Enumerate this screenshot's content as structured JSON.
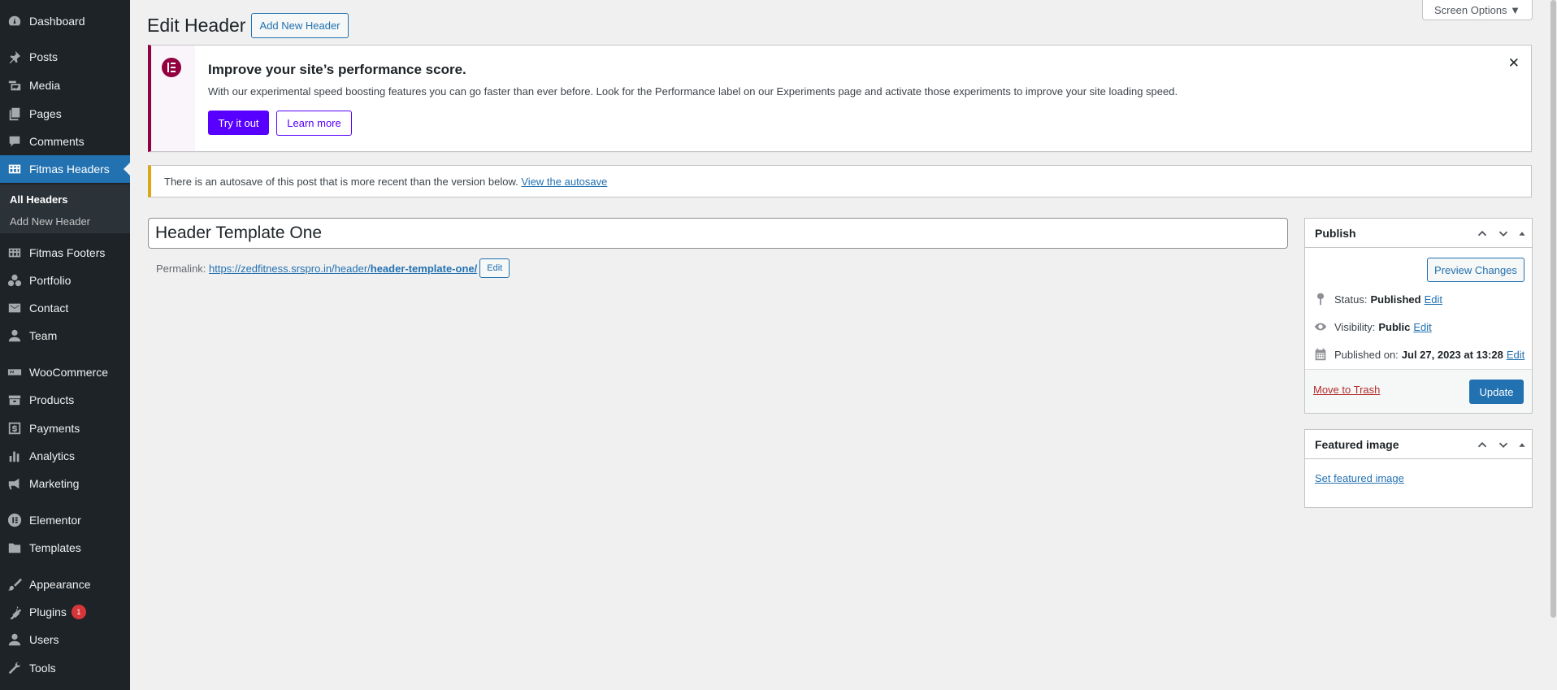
{
  "sidebar": {
    "items": [
      {
        "label": "Dashboard",
        "icon": "dashboard-icon"
      },
      {
        "label": "Posts",
        "icon": "pin-icon"
      },
      {
        "label": "Media",
        "icon": "media-icon"
      },
      {
        "label": "Pages",
        "icon": "pages-icon"
      },
      {
        "label": "Comments",
        "icon": "comments-icon"
      },
      {
        "label": "Fitmas Headers",
        "icon": "grid-icon"
      },
      {
        "label": "Fitmas Footers",
        "icon": "grid-icon"
      },
      {
        "label": "Portfolio",
        "icon": "portfolio-icon"
      },
      {
        "label": "Contact",
        "icon": "mail-icon"
      },
      {
        "label": "Team",
        "icon": "user-icon"
      },
      {
        "label": "WooCommerce",
        "icon": "woo-icon"
      },
      {
        "label": "Products",
        "icon": "products-icon"
      },
      {
        "label": "Payments",
        "icon": "payments-icon"
      },
      {
        "label": "Analytics",
        "icon": "analytics-icon"
      },
      {
        "label": "Marketing",
        "icon": "megaphone-icon"
      },
      {
        "label": "Elementor",
        "icon": "elementor-icon"
      },
      {
        "label": "Templates",
        "icon": "folder-icon"
      },
      {
        "label": "Appearance",
        "icon": "brush-icon"
      },
      {
        "label": "Plugins",
        "icon": "plugin-icon",
        "badge": "1"
      },
      {
        "label": "Users",
        "icon": "user-icon"
      },
      {
        "label": "Tools",
        "icon": "wrench-icon"
      }
    ],
    "submenu": {
      "all": "All Headers",
      "add": "Add New Header"
    }
  },
  "header": {
    "title": "Edit Header",
    "add_new": "Add New Header",
    "screen_options": "Screen Options ▼"
  },
  "notice": {
    "title": "Improve your site’s performance score.",
    "text": "With our experimental speed boosting features you can go faster than ever before. Look for the Performance label on our Experiments page and activate those experiments to improve your site loading speed.",
    "try": "Try it out",
    "learn": "Learn more",
    "close": "✕"
  },
  "autosave": {
    "text": "There is an autosave of this post that is more recent than the version below.",
    "link": "View the autosave"
  },
  "editor": {
    "title_value": "Header Template One",
    "permalink_label": "Permalink:",
    "permalink_base": "https://zedfitness.srspro.in/header/",
    "permalink_slug": "header-template-one/",
    "edit": "Edit"
  },
  "publish": {
    "title": "Publish",
    "preview": "Preview Changes",
    "status_label": "Status:",
    "status_value": "Published",
    "visibility_label": "Visibility:",
    "visibility_value": "Public",
    "published_label": "Published on:",
    "published_value": "Jul 27, 2023 at 13:28",
    "edit": "Edit",
    "trash": "Move to Trash",
    "update": "Update"
  },
  "featured": {
    "title": "Featured image",
    "set": "Set featured image"
  },
  "colors": {
    "sidebar_bg": "#1d2327",
    "accent": "#2271b1",
    "elementor": "#93003f",
    "try_button": "#5800ff"
  }
}
